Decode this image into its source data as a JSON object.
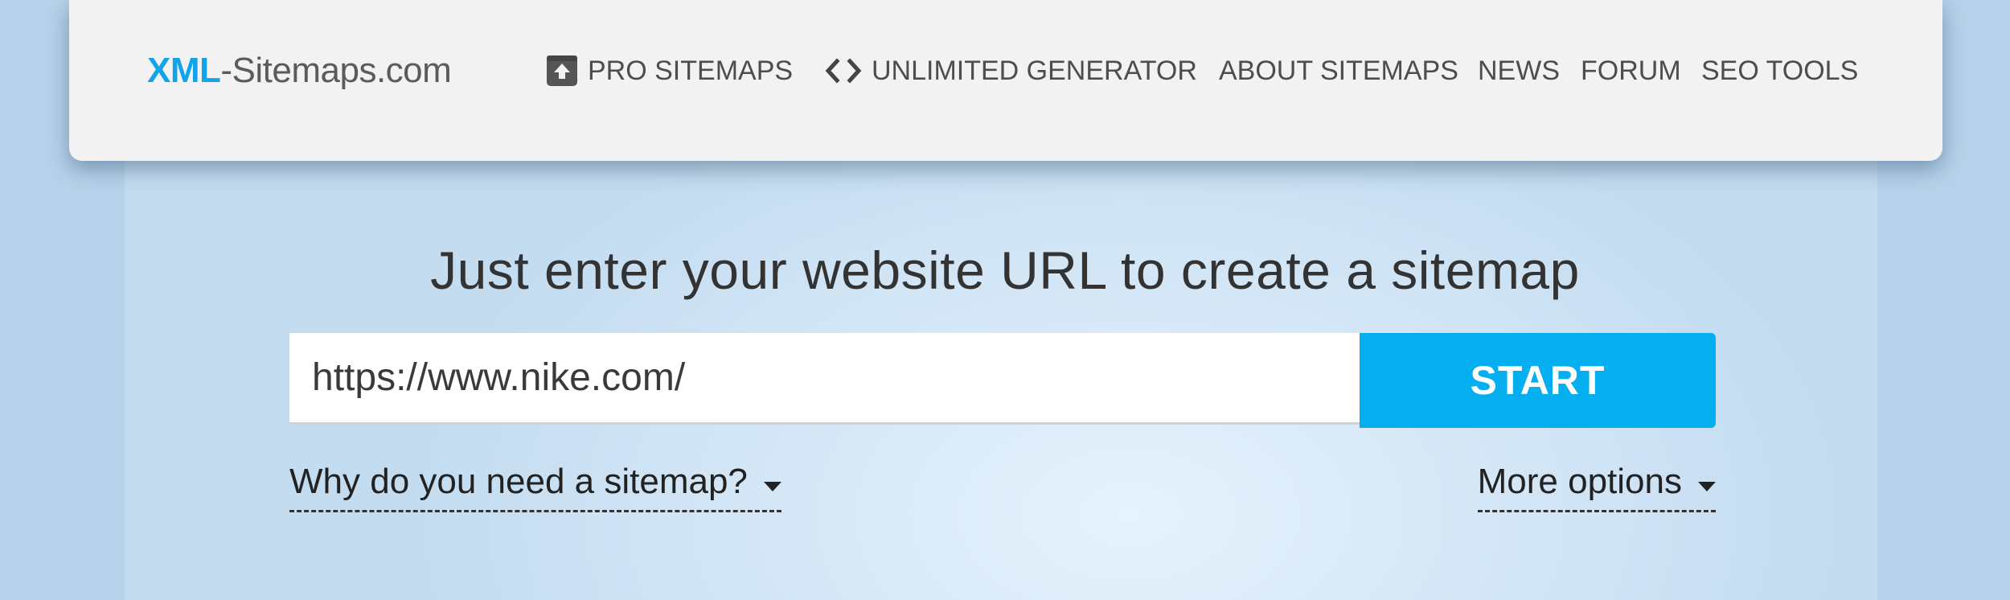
{
  "logo": {
    "part1": "XML",
    "part2": "-Sitemaps.com",
    "accent_color": "#11a4e8"
  },
  "nav": {
    "items": [
      {
        "label": "PRO SITEMAPS",
        "icon": "upload-box-icon"
      },
      {
        "label": "UNLIMITED GENERATOR",
        "icon": "code-brackets-icon"
      },
      {
        "label": "ABOUT SITEMAPS"
      },
      {
        "label": "NEWS"
      },
      {
        "label": "FORUM"
      },
      {
        "label": "SEO TOOLS"
      }
    ]
  },
  "hero": {
    "heading": "Just enter your website URL to create a sitemap",
    "url_value": "https://www.nike.com/",
    "start_label": "START",
    "start_color": "#04aeef",
    "why_label": "Why do you need a sitemap?",
    "more_label": "More options",
    "caret_icon": "caret-down-icon"
  }
}
